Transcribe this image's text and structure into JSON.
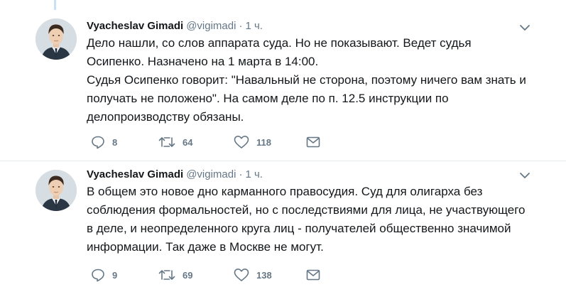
{
  "tweets": [
    {
      "author": {
        "name": "Vyacheslav Gimadi",
        "handle": "@vigimadi"
      },
      "separator": "·",
      "time": "1 ч.",
      "text": [
        "Дело нашли, со слов аппарата суда. Но не показывают. Ведет судья Осипенко. Назначено на 1 марта в 14:00.",
        "Судья Осипенко говорит: \"Навальный не сторона, поэтому ничего вам знать и получать не положено\". На самом деле по п. 12.5 инструкции по делопроизводству обязаны."
      ],
      "actions": {
        "replies": "8",
        "retweets": "64",
        "likes": "118"
      }
    },
    {
      "author": {
        "name": "Vyacheslav Gimadi",
        "handle": "@vigimadi"
      },
      "separator": "·",
      "time": "1 ч.",
      "text": [
        "В общем это новое дно карманного правосудия. Суд  для олигарха без соблюдения формальностей, но с последствиями для лица, не участвующего в деле, и неопределенного круга лиц - получателей общественно значимой информации. Так даже в Москве не могут."
      ],
      "actions": {
        "replies": "9",
        "retweets": "69",
        "likes": "138"
      }
    }
  ],
  "icons": {
    "reply": "speech-bubble-icon",
    "retweet": "retweet-arrows-icon",
    "like": "heart-outline-icon",
    "message": "envelope-icon",
    "menu": "chevron-down-icon"
  },
  "colors": {
    "text": "#14171a",
    "secondary": "#657786",
    "thread_line": "#c8e1f7",
    "divider": "#e6ecf0"
  }
}
